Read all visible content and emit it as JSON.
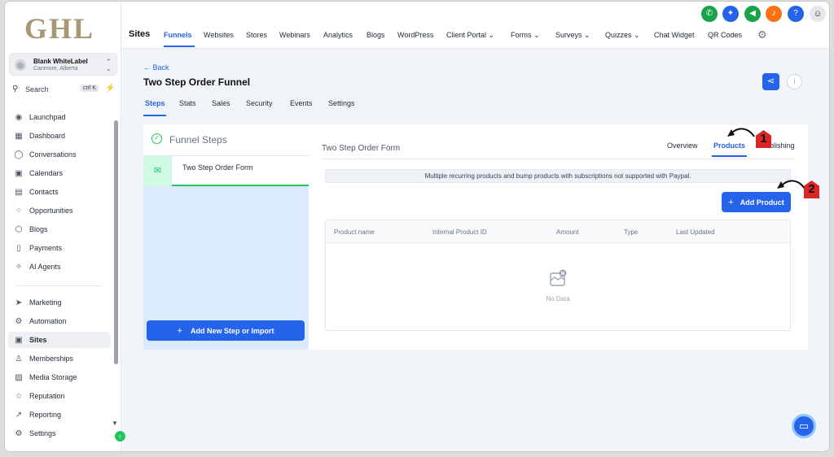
{
  "logo_text": "GHL",
  "account": {
    "name": "Blank WhiteLabel",
    "location": "Canmore, Alberta"
  },
  "search": {
    "label": "Search",
    "shortcut": "ctrl K"
  },
  "sidebar": {
    "items": [
      {
        "label": "Launchpad",
        "icon": "rocket-icon",
        "glyph": "◉"
      },
      {
        "label": "Dashboard",
        "icon": "grid-icon",
        "glyph": "▦"
      },
      {
        "label": "Conversations",
        "icon": "chat-bubble-icon",
        "glyph": "◯"
      },
      {
        "label": "Calendars",
        "icon": "calendar-icon",
        "glyph": "▣"
      },
      {
        "label": "Contacts",
        "icon": "contact-card-icon",
        "glyph": "▤"
      },
      {
        "label": "Opportunities",
        "icon": "network-icon",
        "glyph": "⁘"
      },
      {
        "label": "Blogs",
        "icon": "cube-icon",
        "glyph": "⬡"
      },
      {
        "label": "Payments",
        "icon": "receipt-icon",
        "glyph": "▯"
      },
      {
        "label": "AI Agents",
        "icon": "sparkle-icon",
        "glyph": "✧"
      },
      {
        "label": "Marketing",
        "icon": "send-icon",
        "glyph": "➤"
      },
      {
        "label": "Automation",
        "icon": "automation-icon",
        "glyph": "⚙"
      },
      {
        "label": "Sites",
        "icon": "sites-icon",
        "glyph": "▣"
      },
      {
        "label": "Memberships",
        "icon": "membership-icon",
        "glyph": "♙"
      },
      {
        "label": "Media Storage",
        "icon": "image-icon",
        "glyph": "▨"
      },
      {
        "label": "Reputation",
        "icon": "star-icon",
        "glyph": "☆"
      },
      {
        "label": "Reporting",
        "icon": "trend-icon",
        "glyph": "↗"
      },
      {
        "label": "Settings",
        "icon": "settings-icon",
        "glyph": "⚙"
      }
    ]
  },
  "topbar": {
    "title": "Sites",
    "nav": [
      "Funnels",
      "Websites",
      "Stores",
      "Webinars",
      "Analytics",
      "Blogs",
      "WordPress",
      "Client Portal",
      "Forms",
      "Surveys",
      "Quizzes",
      "Chat Widget",
      "QR Codes"
    ],
    "icon_colors": {
      "phone": "#16a34a",
      "magic": "#2563eb",
      "announce": "#16a34a",
      "bell": "#f97316",
      "help": "#2563eb"
    }
  },
  "funnel": {
    "back_label": "← Back",
    "title": "Two Step Order Funnel",
    "tabs": [
      "Steps",
      "Stats",
      "Sales",
      "Security",
      "Events",
      "Settings"
    ]
  },
  "steps_panel": {
    "heading": "Funnel Steps",
    "step_name": "Two Step Order Form",
    "add_button": "Add New Step or Import"
  },
  "detail": {
    "title": "Two Step Order Form",
    "tabs": [
      "Overview",
      "Products",
      "Publishing"
    ],
    "notice": "Multiple recurring products and bump products with subscriptions not supported with Paypal.",
    "add_product_label": "Add Product",
    "table_headers": [
      "Product name",
      "Internal Product ID",
      "Amount",
      "Type",
      "Last Updated"
    ],
    "empty_text": "No Data"
  },
  "annotations": {
    "marker1": "1",
    "marker2": "2"
  },
  "colors": {
    "accent": "#2563eb",
    "success": "#22c55e",
    "marker": "#dc2626"
  }
}
